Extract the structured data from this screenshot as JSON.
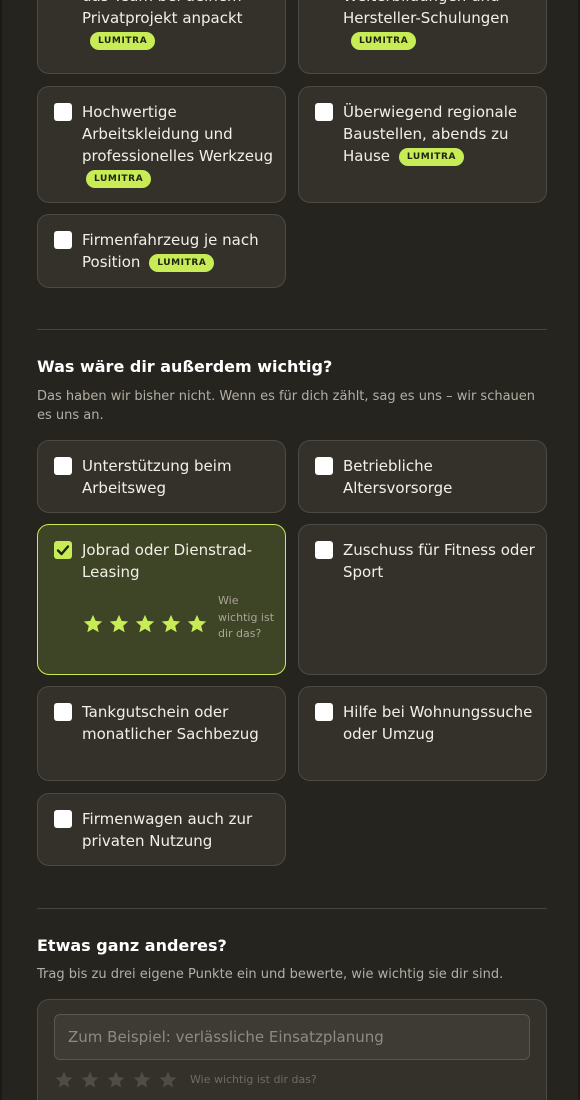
{
  "benefits_offered": [
    {
      "label": "das Team bei deinem Privatprojekt anpackt",
      "badge": "LUMITRA",
      "checked": false
    },
    {
      "label": "Weiterbildungen und Hersteller-Schulungen",
      "badge": "LUMITRA",
      "checked": false
    },
    {
      "label": "Hochwertige Arbeitskleidung und professionelles Werkzeug",
      "badge": "LUMITRA",
      "checked": false
    },
    {
      "label": "Überwiegend regionale Baustellen, abends zu Hause",
      "badge": "LUMITRA",
      "checked": false
    },
    {
      "label": "Firmenfahrzeug je nach Position",
      "badge": "LUMITRA",
      "checked": false
    }
  ],
  "extras": {
    "title": "Was wäre dir außerdem wichtig?",
    "subtitle": "Das haben wir bisher nicht. Wenn es für dich zählt, sag es uns – wir schauen es uns an.",
    "items": [
      {
        "label": "Unterstützung beim Arbeitsweg",
        "checked": false
      },
      {
        "label": "Betriebliche Altersvorsorge",
        "checked": false
      },
      {
        "label": "Jobrad oder Dienstrad-Leasing",
        "checked": true,
        "rating": 5,
        "rating_max": 5,
        "rating_hint": "Wie wichtig ist dir das?"
      },
      {
        "label": "Zuschuss für Fitness oder Sport",
        "checked": false
      },
      {
        "label": "Tankgutschein oder monatlicher Sachbezug",
        "checked": false
      },
      {
        "label": "Hilfe bei Wohnungssuche oder Umzug",
        "checked": false
      },
      {
        "label": "Firmenwagen auch zur privaten Nutzung",
        "checked": false
      }
    ]
  },
  "custom": {
    "title": "Etwas ganz anderes?",
    "subtitle": "Trag bis zu drei eigene Punkte ein und bewerte, wie wichtig sie dir sind.",
    "input_value": "",
    "input_placeholder": "Zum Beispiel: verlässliche Einsatzplanung",
    "rating": 0,
    "rating_max": 5,
    "rating_hint": "Wie wichtig ist dir das?"
  },
  "colors": {
    "accent": "#c8ec55",
    "background": "#26241f",
    "card": "#34312b"
  }
}
